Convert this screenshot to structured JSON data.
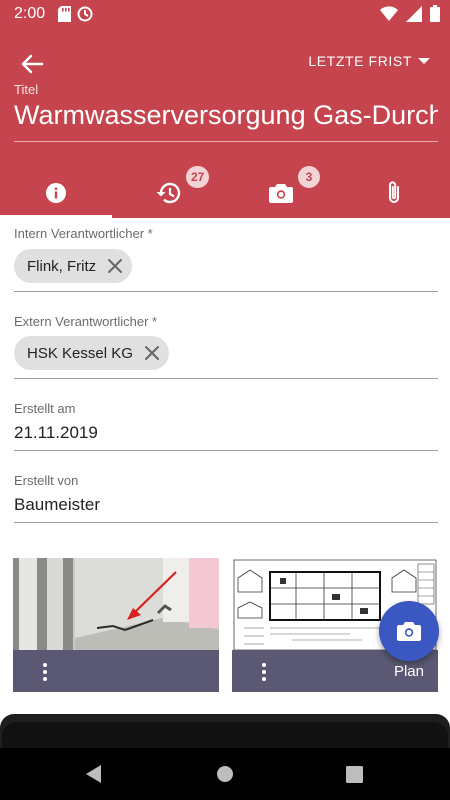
{
  "status_bar": {
    "time": "2:00",
    "icons_left": [
      "sd-card-icon",
      "sync-icon"
    ],
    "icons_right": [
      "wifi-icon",
      "signal-icon",
      "battery-icon"
    ]
  },
  "header": {
    "back_icon": "arrow-back-icon",
    "deadline_label": "LETZTE FRIST",
    "title_label": "Titel",
    "title_value": "Warmwasserversorgung Gas-Durchlauferhitzer"
  },
  "tabs": [
    {
      "icon": "info-icon",
      "badge": "",
      "active": true
    },
    {
      "icon": "history-icon",
      "badge": "27",
      "active": false
    },
    {
      "icon": "camera-icon",
      "badge": "3",
      "active": false
    },
    {
      "icon": "attachment-icon",
      "badge": "",
      "active": false
    }
  ],
  "fields": {
    "internal_responsible": {
      "label": "Intern Verantwortlicher *",
      "chip": "Flink, Fritz"
    },
    "external_responsible": {
      "label": "Extern Verantwortlicher *",
      "chip": "HSK Kessel KG"
    },
    "created_on": {
      "label": "Erstellt am",
      "value": "21.11.2019"
    },
    "created_by": {
      "label": "Erstellt von",
      "value": "Baumeister"
    }
  },
  "attachments": [
    {
      "type": "photo",
      "caption": ""
    },
    {
      "type": "plan",
      "caption": "Plan"
    }
  ],
  "colors": {
    "primary": "#c6444d",
    "badge_bg": "#f2d4d6",
    "fab": "#3a57c2",
    "thumb_footer": "#5a5872"
  }
}
